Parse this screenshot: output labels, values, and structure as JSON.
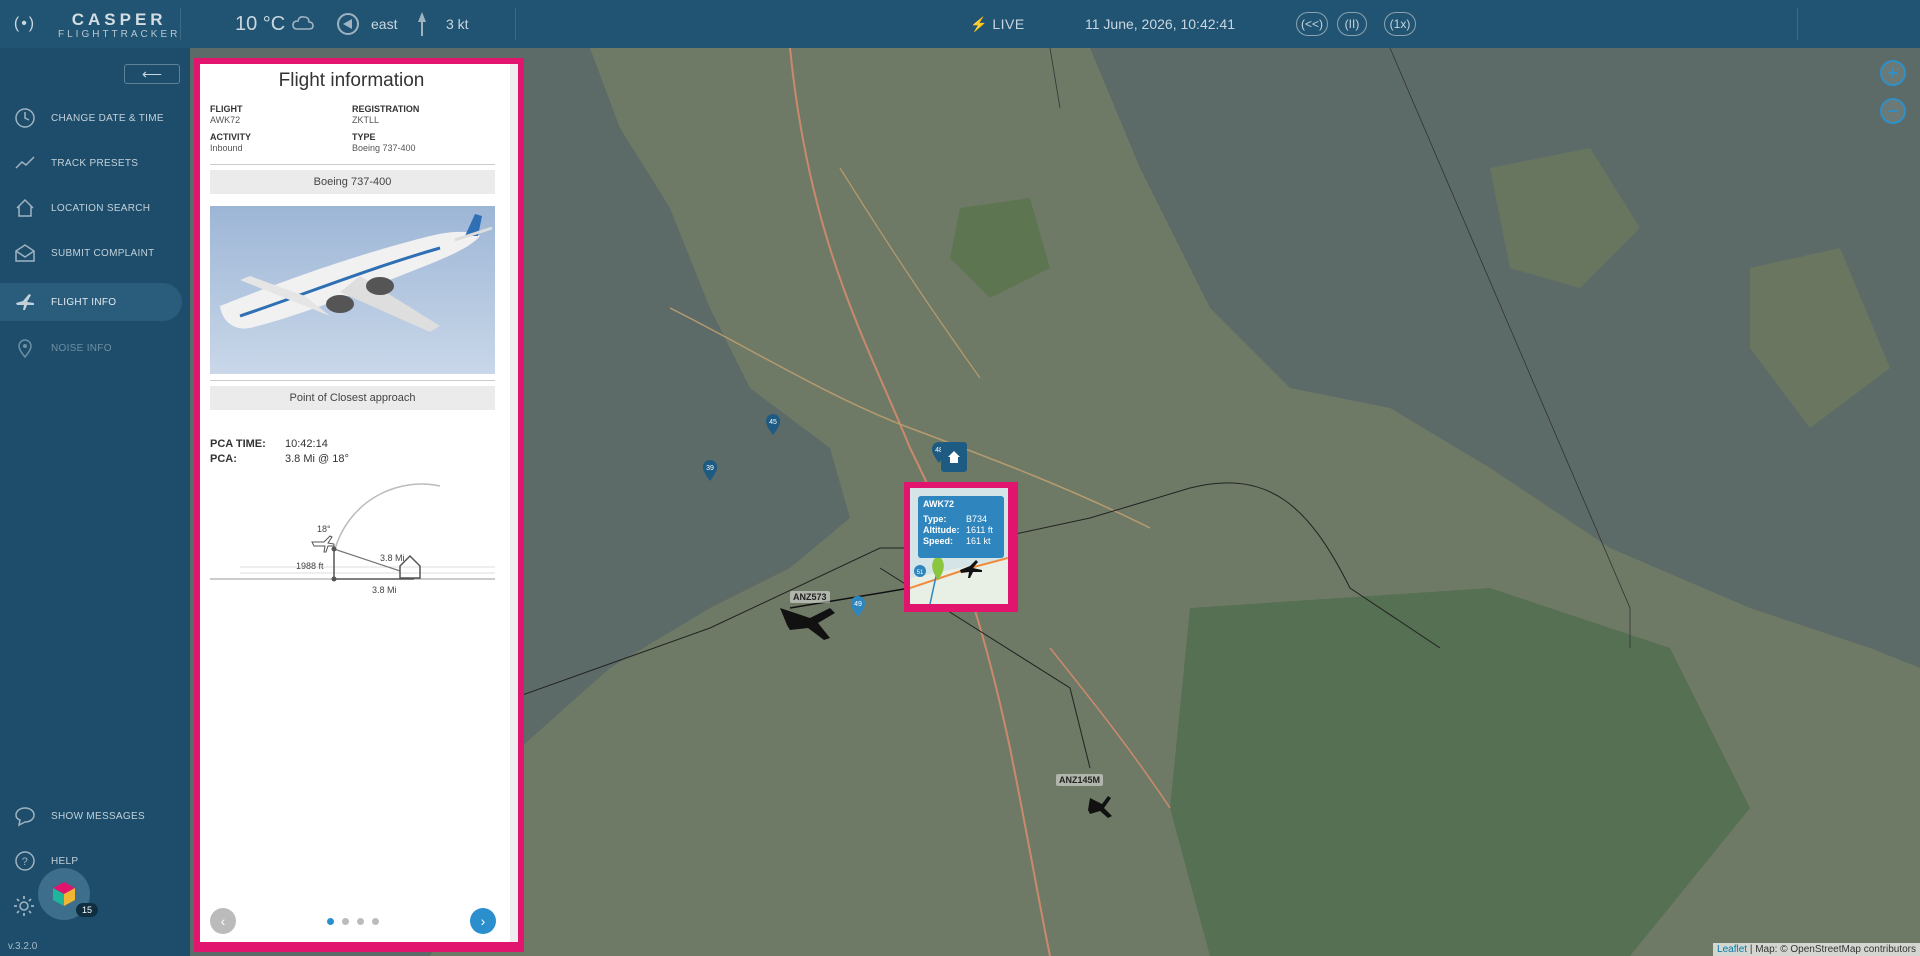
{
  "app": {
    "logo_title": "CASPER",
    "logo_subtitle": "FLIGHTTRACKER",
    "logo_mark": "(•)",
    "version": "v.3.2.0"
  },
  "topbar": {
    "temperature": "10 °C",
    "weather_icon": "cloud-icon",
    "wind_direction": "east",
    "wind_speed": "3 kt",
    "live_label": "LIVE",
    "datetime": "11 June, 2026, 10:42:41",
    "rewind_label": "(<<)",
    "pause_label": "(II)",
    "speed_label": "(1x)"
  },
  "sidebar": {
    "collapse_icon": "arrow-left-icon",
    "items": [
      {
        "label": "CHANGE DATE & TIME",
        "icon": "clock-icon",
        "state": "normal"
      },
      {
        "label": "TRACK PRESETS",
        "icon": "chart-line-icon",
        "state": "normal"
      },
      {
        "label": "LOCATION SEARCH",
        "icon": "home-icon",
        "state": "normal"
      },
      {
        "label": "SUBMIT COMPLAINT",
        "icon": "envelope-icon",
        "state": "normal"
      },
      {
        "label": "FLIGHT INFO",
        "icon": "plane-icon",
        "state": "active"
      },
      {
        "label": "NOISE INFO",
        "icon": "map-pin-icon",
        "state": "disabled"
      }
    ],
    "bottom_items": [
      {
        "label": "SHOW MESSAGES",
        "icon": "chat-icon"
      },
      {
        "label": "HELP",
        "icon": "help-icon"
      }
    ],
    "notifications_count": "15"
  },
  "flight_panel": {
    "title": "Flight information",
    "fields": {
      "flight_label": "FLIGHT",
      "flight_value": "AWK72",
      "registration_label": "REGISTRATION",
      "registration_value": "ZKTLL",
      "activity_label": "ACTIVITY",
      "activity_value": "Inbound",
      "type_label": "TYPE",
      "type_value": "Boeing 737-400"
    },
    "aircraft_heading": "Boeing 737-400",
    "pca_heading": "Point of Closest approach",
    "pca_time_label": "PCA TIME:",
    "pca_time_value": "10:42:14",
    "pca_label": "PCA:",
    "pca_value": "3.8 Mi @ 18°",
    "diagram": {
      "angle": "18°",
      "slant_distance": "3.8 Mi",
      "altitude": "1988 ft",
      "ground_distance": "3.8 Mi"
    },
    "pager": {
      "pages": 4,
      "current": 1
    }
  },
  "map": {
    "zoom_in": "+",
    "zoom_out": "−",
    "attribution_leaflet": "Leaflet",
    "attribution_rest": "| Map: © OpenStreetMap contributors",
    "flight_labels": [
      "ANZ573",
      "ANZ145M"
    ],
    "pins": [
      "45",
      "39",
      "48",
      "49",
      "51"
    ],
    "popup": {
      "callsign": "AWK72",
      "type_label": "Type:",
      "type_value": "B734",
      "altitude_label": "Altitude:",
      "altitude_value": "1611 ft",
      "speed_label": "Speed:",
      "speed_value": "161 kt"
    }
  },
  "colors": {
    "topbar": "#215472",
    "sidebar": "#1d4d6a",
    "highlight": "#e1156d",
    "accent": "#2b8fce"
  }
}
